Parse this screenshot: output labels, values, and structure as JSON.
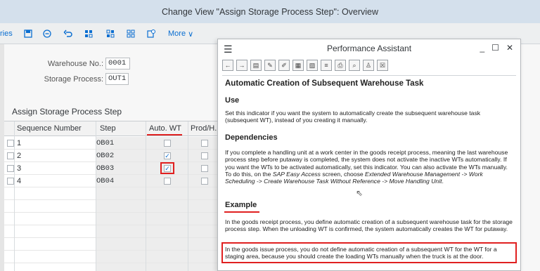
{
  "window": {
    "title": "Change View \"Assign Storage Process Step\": Overview"
  },
  "toolbar": {
    "partial_text": "ries",
    "icons": [
      "save-icon",
      "minus-circle-icon",
      "undo-icon",
      "select-all-icon",
      "select-block-icon",
      "deselect-icon",
      "info-icon"
    ],
    "more_label": "More",
    "more_chevron": "∨"
  },
  "form": {
    "warehouse_label": "Warehouse No.:",
    "warehouse_value": "0001",
    "process_label": "Storage Process:",
    "process_value": "OUT1"
  },
  "table": {
    "title": "Assign Storage Process Step",
    "headers": [
      "Sequence Number",
      "Step",
      "Auto. WT",
      "Prod/H..."
    ],
    "rows": [
      {
        "seq": "1",
        "step": "OB01",
        "auto_wt": false,
        "prod": false
      },
      {
        "seq": "2",
        "step": "OB02",
        "auto_wt": true,
        "prod": false
      },
      {
        "seq": "3",
        "step": "OB03",
        "auto_wt": true,
        "prod": false
      },
      {
        "seq": "4",
        "step": "OB04",
        "auto_wt": false,
        "prod": false
      }
    ]
  },
  "assistant": {
    "title": "Performance Assistant",
    "menu_icon": "☰",
    "controls": {
      "minimize": "_",
      "maximize": "☐",
      "close": "✕"
    },
    "heading": "Automatic Creation of Subsequent Warehouse Task",
    "use_heading": "Use",
    "use_text": "Set this indicator if you want the system to automatically create the subsequent warehouse task (subsequent WT), instead of you creating it manually.",
    "dependencies_heading": "Dependencies",
    "dependencies_text_1": "If you complete a handling unit at a work center in the goods receipt process, meaning the last warehouse process step before putaway is completed, the system does not activate the inactive WTs automatically. If you want the WTs to be activated automatically, set this indicator. You can also activate the WTs manually. To do this, on the ",
    "dependencies_italic_1": "SAP Easy Access",
    "dependencies_text_2": " screen, choose ",
    "dependencies_italic_2": "Extended Warehouse Management -> Work Scheduling -> Create Warehouse Task Without Reference -> Move Handling Unit",
    "dependencies_text_3": ".",
    "example_heading": "Example",
    "example_text_1": "In the goods receipt process, you define automatic creation of a subsequent warehouse task for the storage process step. When the unloading WT is confirmed, the system automatically creates the WT for putaway.",
    "example_text_2": "In the goods issue process, you do not define automatic creation of a subsequent WT for the WT for a staging area, because you should create the loading WTs manually when the truck is at the door."
  },
  "colors": {
    "accent": "#0a6ed1",
    "highlight": "#e02020",
    "titlebar": "#d4e0ec"
  }
}
